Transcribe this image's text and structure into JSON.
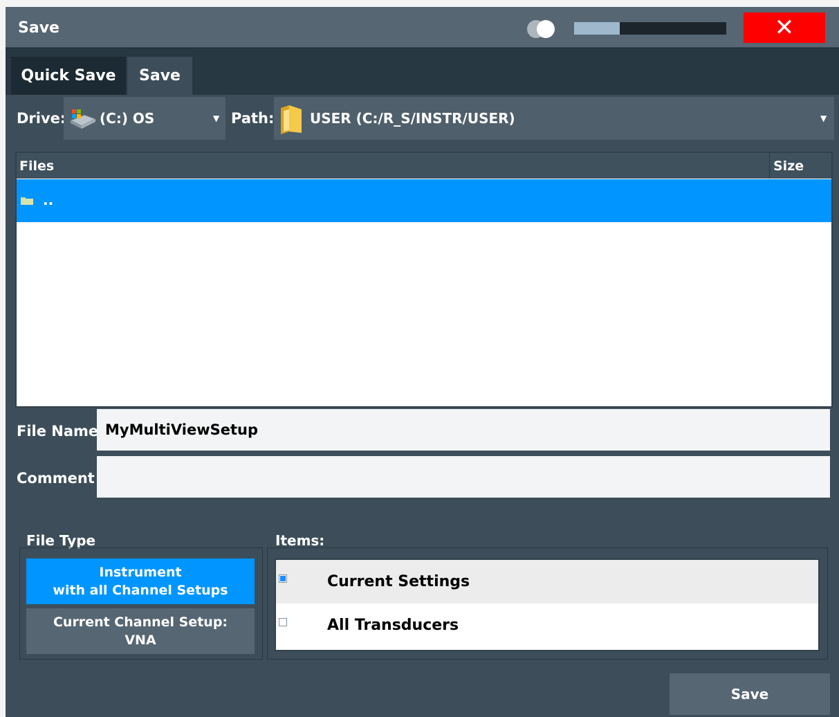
{
  "window": {
    "title": "Save",
    "progress_fraction": 0.3
  },
  "tabs": [
    {
      "label": "Quick Save"
    },
    {
      "label": "Save"
    }
  ],
  "drive": {
    "label": "Drive:",
    "value": "(C:) OS"
  },
  "path": {
    "label": "Path:",
    "value": "USER (C:/R_S/INSTR/USER)"
  },
  "files": {
    "columns": [
      "Files",
      "Size"
    ],
    "rows": [
      {
        "name": "..",
        "size": ""
      }
    ]
  },
  "file_name": {
    "label": "File Name",
    "value": "MyMultiViewSetup"
  },
  "comment": {
    "label": "Comment",
    "value": ""
  },
  "file_type": {
    "label": "File Type",
    "options": [
      {
        "line1": "Instrument",
        "line2": "with all Channel Setups",
        "selected": true
      },
      {
        "line1": "Current Channel Setup:",
        "line2": "VNA",
        "selected": false
      }
    ]
  },
  "items": {
    "label": "Items:",
    "list": [
      {
        "label": "Current Settings",
        "checked": true
      },
      {
        "label": "All Transducers",
        "checked": false
      }
    ]
  },
  "save_button": {
    "label": "Save"
  },
  "colors": {
    "accent": "#0095ff",
    "close": "#ff0000",
    "panel": "#3d4e5a",
    "titlebar": "#566673"
  }
}
